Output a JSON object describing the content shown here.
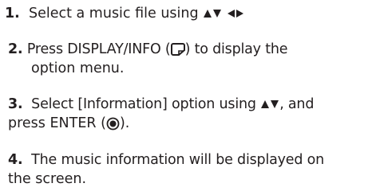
{
  "steps": [
    {
      "num": "1.",
      "text_a": "Select a music file using ",
      "icons": [
        "arrow-up-icon",
        "arrow-down-icon",
        "arrow-left-icon",
        "arrow-right-icon"
      ]
    },
    {
      "num": "2.",
      "text_a": "Press DISPLAY/INFO (",
      "icon": "display-info-icon",
      "text_b": ") to display the",
      "text_c": "option menu."
    },
    {
      "num": "3.",
      "text_a": "Select [Information] option using ",
      "icons": [
        "arrow-up-icon",
        "arrow-down-icon"
      ],
      "text_b": ", and",
      "text_c": "press ENTER (",
      "icon2": "enter-icon",
      "text_d": ")."
    },
    {
      "num": "4.",
      "text_a": "The music information will be displayed on",
      "text_b": "the screen."
    }
  ],
  "colors": {
    "text": "#231f20",
    "background": "#ffffff"
  }
}
